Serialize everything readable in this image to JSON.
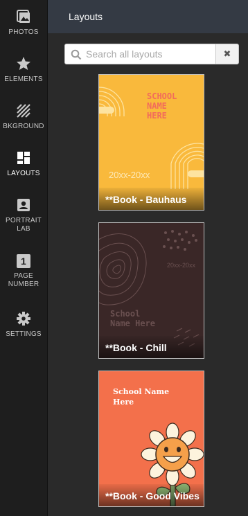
{
  "sidebar": {
    "items": [
      {
        "label": "PHOTOS",
        "icon": "photos-icon"
      },
      {
        "label": "ELEMENTS",
        "icon": "star-icon"
      },
      {
        "label": "BKGROUND",
        "icon": "background-stripes-icon"
      },
      {
        "label": "LAYOUTS",
        "icon": "layouts-grid-icon",
        "active": true
      },
      {
        "label_line1": "PORTRAIT",
        "label_line2": "LAB",
        "icon": "portrait-icon"
      },
      {
        "label_line1": "PAGE",
        "label_line2": "NUMBER",
        "icon": "page-number-icon",
        "icon_text": "1"
      },
      {
        "label": "SETTINGS",
        "icon": "gear-icon"
      }
    ]
  },
  "header": {
    "title": "Layouts"
  },
  "search": {
    "placeholder": "Search all layouts",
    "value": "",
    "clear_icon": "close-icon"
  },
  "layouts": [
    {
      "name": "**Book - Bauhaus",
      "bg": "#f9b93c",
      "title_lines": [
        "SCHOOL",
        "NAME",
        "HERE"
      ],
      "date": "20xx-20xx"
    },
    {
      "name": "**Book - Chill",
      "bg": "#3a2727",
      "title_lines": [
        "School",
        "Name Here"
      ],
      "date": "20xx-20xx"
    },
    {
      "name": "**Book - Good Vibes",
      "bg": "#f3704b",
      "title_lines": [
        "School Name",
        "Here"
      ]
    }
  ],
  "colors": {
    "rail_bg": "#1e1e1e",
    "panel_bg": "#2a2a2a",
    "header_bg": "#343a44",
    "bauhaus_accent": "#f26b5b",
    "chill_pattern": "#6a5050"
  }
}
